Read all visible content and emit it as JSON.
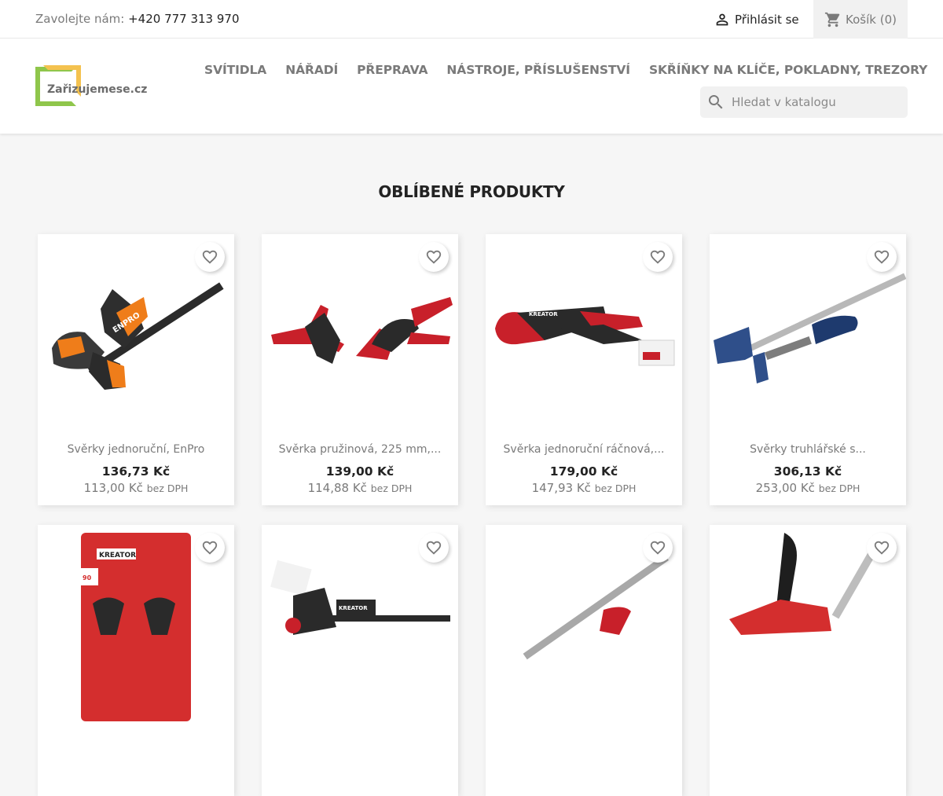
{
  "topbar": {
    "contact_label": "Zavolejte nám:",
    "phone": "+420 777 313 970",
    "login": "Přihlásit se",
    "cart_label": "Košík",
    "cart_count": "(0)"
  },
  "header": {
    "logo_text": "Zařizujemese.cz",
    "nav": [
      "SVÍTIDLA",
      "NÁŘADÍ",
      "PŘEPRAVA",
      "NÁSTROJE, PŘÍSLUŠENSTVÍ",
      "SKŘÍŇKY NA KLÍČE, POKLADNY, TREZORY"
    ],
    "search_placeholder": "Hledat v katalogu"
  },
  "section": {
    "title": "OBLÍBENÉ PRODUKTY"
  },
  "products": [
    {
      "name": "Svěrky jednoruční, EnPro",
      "price": "136,73 Kč",
      "price_net": "113,00 Kč",
      "tax_label": "bez DPH"
    },
    {
      "name": "Svěrka pružinová, 225 mm,...",
      "price": "139,00 Kč",
      "price_net": "114,88 Kč",
      "tax_label": "bez DPH"
    },
    {
      "name": "Svěrka jednoruční ráčnová,...",
      "price": "179,00 Kč",
      "price_net": "147,93 Kč",
      "tax_label": "bez DPH"
    },
    {
      "name": "Svěrky truhlářské s...",
      "price": "306,13 Kč",
      "price_net": "253,00 Kč",
      "tax_label": "bez DPH"
    },
    {
      "name": "",
      "price": "",
      "price_net": "",
      "tax_label": ""
    },
    {
      "name": "",
      "price": "",
      "price_net": "",
      "tax_label": ""
    },
    {
      "name": "",
      "price": "",
      "price_net": "",
      "tax_label": ""
    },
    {
      "name": "",
      "price": "",
      "price_net": "",
      "tax_label": ""
    }
  ],
  "icons": {
    "wishlist": "heart-outline-icon",
    "login": "person-icon",
    "cart": "shopping-cart-icon",
    "search": "search-icon"
  },
  "colors": {
    "accent": "#24b9d7",
    "text": "#232323",
    "muted": "#7a7a7a"
  }
}
